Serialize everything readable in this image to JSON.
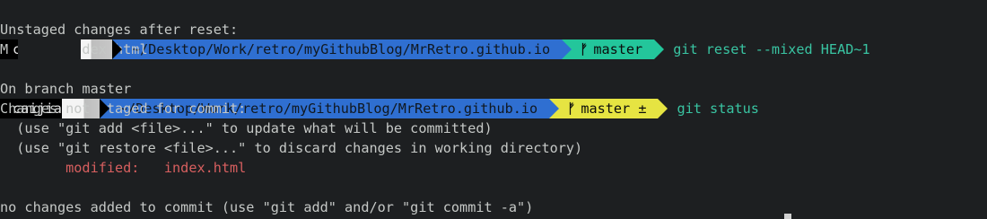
{
  "prompt1": {
    "user": "caijia",
    "dir": "~/Desktop/Work/retro/myGithubBlog/MrRetro.github.io",
    "branch": "master",
    "branch_icon": "ᚠ",
    "dirty_mark": "",
    "command": "git reset --mixed HEAD~1"
  },
  "output1": [
    "Unstaged changes after reset:",
    "M       index.html"
  ],
  "prompt2": {
    "user": "caijia",
    "dir": "~/Desktop/Work/retro/myGithubBlog/MrRetro.github.io",
    "branch": "master ±",
    "branch_icon": "ᚠ",
    "command": "git status"
  },
  "output2": {
    "line1": "On branch master",
    "line2": "Changes not staged for commit:",
    "line3": "  (use \"git add <file>...\" to update what will be committed)",
    "line4": "  (use \"git restore <file>...\" to discard changes in working directory)",
    "modified_label": "        modified:",
    "modified_file": "   index.html",
    "blank": "",
    "final": "no changes added to commit (use \"git add\" and/or \"git commit -a\")"
  },
  "colors": {
    "background": "#1d1f21",
    "dir_segment": "#2f6fd1",
    "git_clean": "#23c69b",
    "git_dirty": "#e6e442",
    "command": "#39c4a2",
    "modified": "#d75f5f"
  }
}
